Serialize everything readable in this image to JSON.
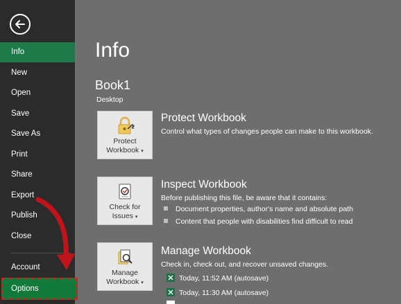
{
  "sidebar": {
    "items": [
      {
        "label": "Info"
      },
      {
        "label": "New"
      },
      {
        "label": "Open"
      },
      {
        "label": "Save"
      },
      {
        "label": "Save As"
      },
      {
        "label": "Print"
      },
      {
        "label": "Share"
      },
      {
        "label": "Export"
      },
      {
        "label": "Publish"
      },
      {
        "label": "Close"
      },
      {
        "label": "Account"
      },
      {
        "label": "Options"
      }
    ]
  },
  "main": {
    "title": "Info",
    "doc_name": "Book1",
    "doc_location": "Desktop",
    "protect": {
      "button_line1": "Protect",
      "button_line2": "Workbook",
      "title": "Protect Workbook",
      "desc": "Control what types of changes people can make to this workbook."
    },
    "inspect": {
      "button_line1": "Check for",
      "button_line2": "Issues",
      "title": "Inspect Workbook",
      "desc": "Before publishing this file, be aware that it contains:",
      "bullets": [
        "Document properties, author's name and absolute path",
        "Content that people with disabilities find difficult to read"
      ]
    },
    "manage": {
      "button_line1": "Manage",
      "button_line2": "Workbook",
      "title": "Manage Workbook",
      "desc": "Check in, check out, and recover unsaved changes.",
      "versions": [
        "Today, 11:52 AM (autosave)",
        "Today, 11:30 AM (autosave)"
      ]
    }
  },
  "colors": {
    "sidebar_bg": "#2b2b2b",
    "active_bg": "#1f7a4a",
    "main_bg": "#6e6e6e",
    "highlight": "#d61f1f"
  }
}
